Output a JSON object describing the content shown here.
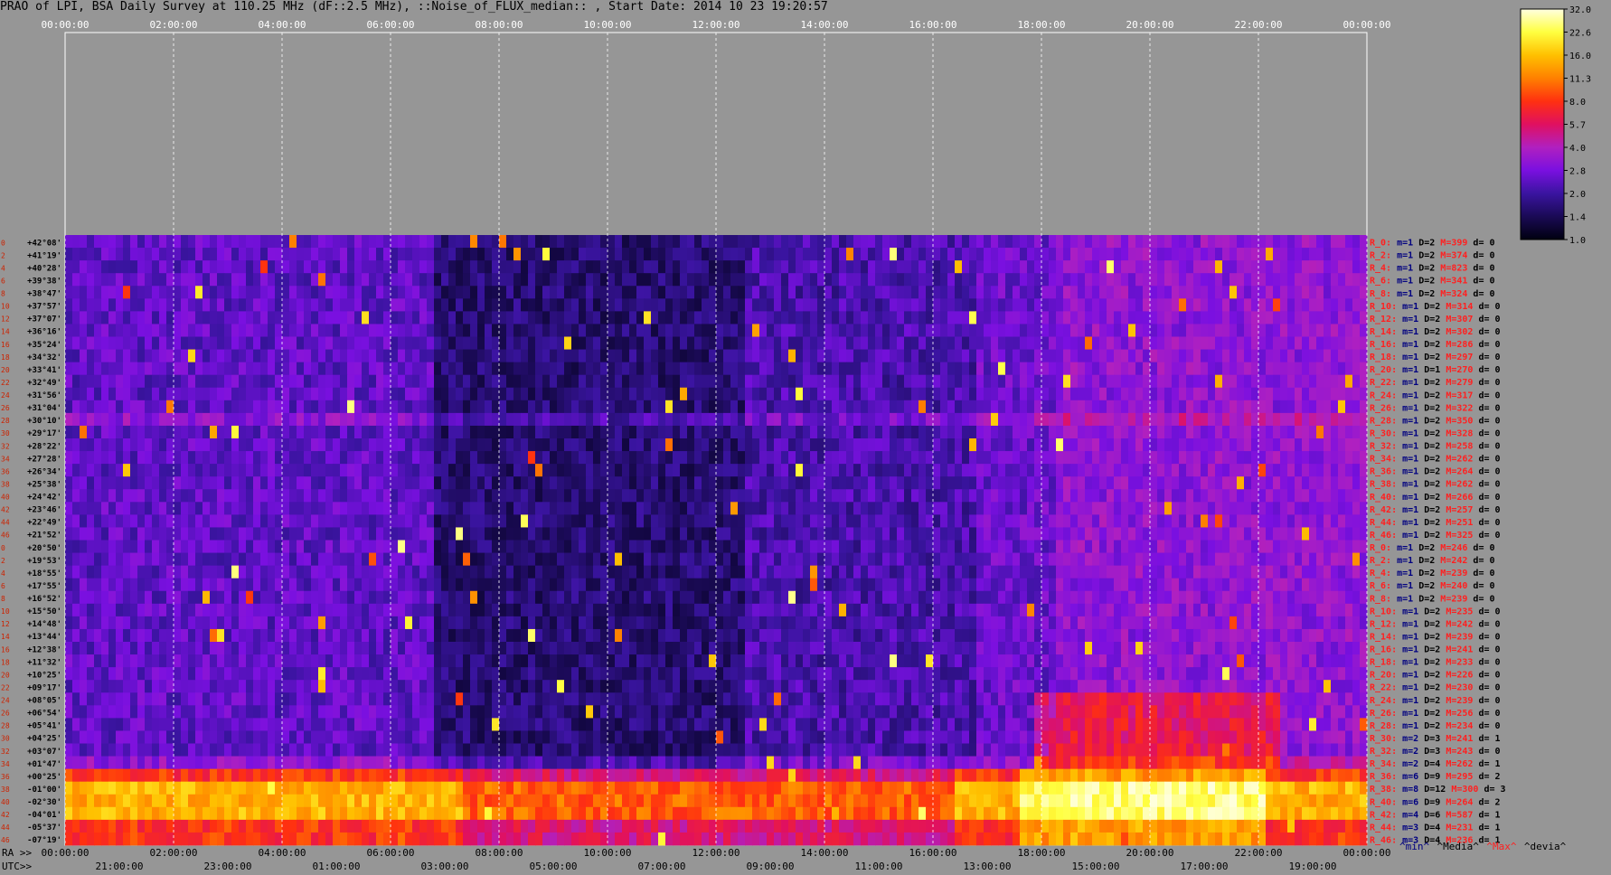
{
  "title": "PRAO of LPI, BSA Daily Survey at 110.25 MHz (dF::2.5 MHz), ::Noise_of_FLUX_median:: , Start Date: 2014 10 23 19:20:57",
  "chart_data": {
    "type": "heatmap",
    "title": "PRAO of LPI, BSA Daily Survey at 110.25 MHz (dF::2.5 MHz), ::Noise_of_FLUX_median:: , Start Date: 2014 10 23 19:20:57",
    "x_top_ticks": [
      "00:00:00",
      "02:00:00",
      "04:00:00",
      "06:00:00",
      "08:00:00",
      "10:00:00",
      "12:00:00",
      "14:00:00",
      "16:00:00",
      "18:00:00",
      "20:00:00",
      "22:00:00",
      "00:00:00"
    ],
    "x_bottom_ra_prefix": "RA >>",
    "x_bottom_ra_ticks": [
      "00:00:00",
      "02:00:00",
      "04:00:00",
      "06:00:00",
      "08:00:00",
      "10:00:00",
      "12:00:00",
      "14:00:00",
      "16:00:00",
      "18:00:00",
      "20:00:00",
      "22:00:00",
      "00:00:00"
    ],
    "x_bottom_utc_prefix": "UTC>>",
    "x_bottom_utc_ticks": [
      "21:00:00",
      "23:00:00",
      "01:00:00",
      "03:00:00",
      "05:00:00",
      "07:00:00",
      "09:00:00",
      "11:00:00",
      "13:00:00",
      "15:00:00",
      "17:00:00",
      "19:00:00"
    ],
    "row_index": [
      "0",
      "2",
      "4",
      "6",
      "8",
      "10",
      "12",
      "14",
      "16",
      "18",
      "20",
      "22",
      "24",
      "26",
      "28",
      "30",
      "32",
      "34",
      "36",
      "38",
      "40",
      "42",
      "44",
      "46",
      "0",
      "2",
      "4",
      "6",
      "8",
      "10",
      "12",
      "14",
      "16",
      "18",
      "20",
      "22",
      "24",
      "26",
      "28",
      "30",
      "32",
      "34",
      "36",
      "38",
      "40",
      "42",
      "44",
      "46"
    ],
    "declinations": [
      "+42°08'",
      "+41°19'",
      "+40°28'",
      "+39°38'",
      "+38°47'",
      "+37°57'",
      "+37°07'",
      "+36°16'",
      "+35°24'",
      "+34°32'",
      "+33°41'",
      "+32°49'",
      "+31°56'",
      "+31°04'",
      "+30°10'",
      "+29°17'",
      "+28°22'",
      "+27°28'",
      "+26°34'",
      "+25°38'",
      "+24°42'",
      "+23°46'",
      "+22°49'",
      "+21°52'",
      "+20°50'",
      "+19°53'",
      "+18°55'",
      "+17°55'",
      "+16°52'",
      "+15°50'",
      "+14°48'",
      "+13°44'",
      "+12°38'",
      "+11°32'",
      "+10°25'",
      "+09°17'",
      "+08°05'",
      "+06°54'",
      "+05°41'",
      "+04°25'",
      "+03°07'",
      "+01°47'",
      "+00°25'",
      "-01°00'",
      "-02°30'",
      "-04°01'",
      "-05°37'",
      "-07°19'"
    ],
    "colorbar": {
      "ticks": [
        "32.0",
        "22.6",
        "16.0",
        "11.3",
        "8.0",
        "5.7",
        "4.0",
        "2.8",
        "2.0",
        "1.4",
        "1.0"
      ],
      "scale": "log",
      "range": [
        1.0,
        32.0
      ]
    },
    "row_stats": [
      {
        "name": "R_0:",
        "m": "m=1",
        "D": "D=2",
        "M": "M=399",
        "d": "d= 0"
      },
      {
        "name": "R_2:",
        "m": "m=1",
        "D": "D=2",
        "M": "M=374",
        "d": "d= 0"
      },
      {
        "name": "R_4:",
        "m": "m=1",
        "D": "D=2",
        "M": "M=823",
        "d": "d= 0"
      },
      {
        "name": "R_6:",
        "m": "m=1",
        "D": "D=2",
        "M": "M=341",
        "d": "d= 0"
      },
      {
        "name": "R_8:",
        "m": "m=1",
        "D": "D=2",
        "M": "M=324",
        "d": "d= 0"
      },
      {
        "name": "R_10:",
        "m": "m=1",
        "D": "D=2",
        "M": "M=314",
        "d": "d= 0"
      },
      {
        "name": "R_12:",
        "m": "m=1",
        "D": "D=2",
        "M": "M=307",
        "d": "d= 0"
      },
      {
        "name": "R_14:",
        "m": "m=1",
        "D": "D=2",
        "M": "M=302",
        "d": "d= 0"
      },
      {
        "name": "R_16:",
        "m": "m=1",
        "D": "D=2",
        "M": "M=286",
        "d": "d= 0"
      },
      {
        "name": "R_18:",
        "m": "m=1",
        "D": "D=2",
        "M": "M=297",
        "d": "d= 0"
      },
      {
        "name": "R_20:",
        "m": "m=1",
        "D": "D=1",
        "M": "M=270",
        "d": "d= 0"
      },
      {
        "name": "R_22:",
        "m": "m=1",
        "D": "D=2",
        "M": "M=279",
        "d": "d= 0"
      },
      {
        "name": "R_24:",
        "m": "m=1",
        "D": "D=2",
        "M": "M=317",
        "d": "d= 0"
      },
      {
        "name": "R_26:",
        "m": "m=1",
        "D": "D=2",
        "M": "M=322",
        "d": "d= 0"
      },
      {
        "name": "R_28:",
        "m": "m=1",
        "D": "D=2",
        "M": "M=350",
        "d": "d= 0"
      },
      {
        "name": "R_30:",
        "m": "m=1",
        "D": "D=2",
        "M": "M=328",
        "d": "d= 0"
      },
      {
        "name": "R_32:",
        "m": "m=1",
        "D": "D=2",
        "M": "M=258",
        "d": "d= 0"
      },
      {
        "name": "R_34:",
        "m": "m=1",
        "D": "D=2",
        "M": "M=262",
        "d": "d= 0"
      },
      {
        "name": "R_36:",
        "m": "m=1",
        "D": "D=2",
        "M": "M=264",
        "d": "d= 0"
      },
      {
        "name": "R_38:",
        "m": "m=1",
        "D": "D=2",
        "M": "M=262",
        "d": "d= 0"
      },
      {
        "name": "R_40:",
        "m": "m=1",
        "D": "D=2",
        "M": "M=266",
        "d": "d= 0"
      },
      {
        "name": "R_42:",
        "m": "m=1",
        "D": "D=2",
        "M": "M=257",
        "d": "d= 0"
      },
      {
        "name": "R_44:",
        "m": "m=1",
        "D": "D=2",
        "M": "M=251",
        "d": "d= 0"
      },
      {
        "name": "R_46:",
        "m": "m=1",
        "D": "D=2",
        "M": "M=325",
        "d": "d= 0"
      },
      {
        "name": "R_0:",
        "m": "m=1",
        "D": "D=2",
        "M": "M=246",
        "d": "d= 0"
      },
      {
        "name": "R_2:",
        "m": "m=1",
        "D": "D=2",
        "M": "M=242",
        "d": "d= 0"
      },
      {
        "name": "R_4:",
        "m": "m=1",
        "D": "D=2",
        "M": "M=239",
        "d": "d= 0"
      },
      {
        "name": "R_6:",
        "m": "m=1",
        "D": "D=2",
        "M": "M=240",
        "d": "d= 0"
      },
      {
        "name": "R_8:",
        "m": "m=1",
        "D": "D=2",
        "M": "M=239",
        "d": "d= 0"
      },
      {
        "name": "R_10:",
        "m": "m=1",
        "D": "D=2",
        "M": "M=235",
        "d": "d= 0"
      },
      {
        "name": "R_12:",
        "m": "m=1",
        "D": "D=2",
        "M": "M=242",
        "d": "d= 0"
      },
      {
        "name": "R_14:",
        "m": "m=1",
        "D": "D=2",
        "M": "M=239",
        "d": "d= 0"
      },
      {
        "name": "R_16:",
        "m": "m=1",
        "D": "D=2",
        "M": "M=241",
        "d": "d= 0"
      },
      {
        "name": "R_18:",
        "m": "m=1",
        "D": "D=2",
        "M": "M=233",
        "d": "d= 0"
      },
      {
        "name": "R_20:",
        "m": "m=1",
        "D": "D=2",
        "M": "M=226",
        "d": "d= 0"
      },
      {
        "name": "R_22:",
        "m": "m=1",
        "D": "D=2",
        "M": "M=230",
        "d": "d= 0"
      },
      {
        "name": "R_24:",
        "m": "m=1",
        "D": "D=2",
        "M": "M=239",
        "d": "d= 0"
      },
      {
        "name": "R_26:",
        "m": "m=1",
        "D": "D=2",
        "M": "M=256",
        "d": "d= 0"
      },
      {
        "name": "R_28:",
        "m": "m=1",
        "D": "D=2",
        "M": "M=234",
        "d": "d= 0"
      },
      {
        "name": "R_30:",
        "m": "m=2",
        "D": "D=3",
        "M": "M=241",
        "d": "d= 1"
      },
      {
        "name": "R_32:",
        "m": "m=2",
        "D": "D=3",
        "M": "M=243",
        "d": "d= 0"
      },
      {
        "name": "R_34:",
        "m": "m=2",
        "D": "D=4",
        "M": "M=262",
        "d": "d= 1"
      },
      {
        "name": "R_36:",
        "m": "m=6",
        "D": "D=9",
        "M": "M=295",
        "d": "d= 2"
      },
      {
        "name": "R_38:",
        "m": "m=8",
        "D": "D=12",
        "M": "M=300",
        "d": "d= 3"
      },
      {
        "name": "R_40:",
        "m": "m=6",
        "D": "D=9",
        "M": "M=264",
        "d": "d= 2"
      },
      {
        "name": "R_42:",
        "m": "m=4",
        "D": "D=6",
        "M": "M=587",
        "d": "d= 1"
      },
      {
        "name": "R_44:",
        "m": "m=3",
        "D": "D=4",
        "M": "M=231",
        "d": "d= 1"
      },
      {
        "name": "R_46:",
        "m": "m=3",
        "D": "D=4",
        "M": "M=236",
        "d": "d= 1"
      }
    ],
    "legend": [
      {
        "text": "^min^",
        "color": "#000080"
      },
      {
        "text": "^Media^",
        "color": "#000000"
      },
      {
        "text": "^Max^",
        "color": "#ff2020"
      },
      {
        "text": "^devia^",
        "color": "#000000"
      }
    ],
    "colors": {
      "ramp": [
        "#000010",
        "#1a0a55",
        "#3a14a0",
        "#7a10e0",
        "#b020c0",
        "#e01060",
        "#ff3010",
        "#ff8000",
        "#ffc000",
        "#ffff40",
        "#ffffe0"
      ],
      "label_red": "#ff2020",
      "label_blue": "#000080",
      "grid_white": "#ffffff"
    }
  }
}
